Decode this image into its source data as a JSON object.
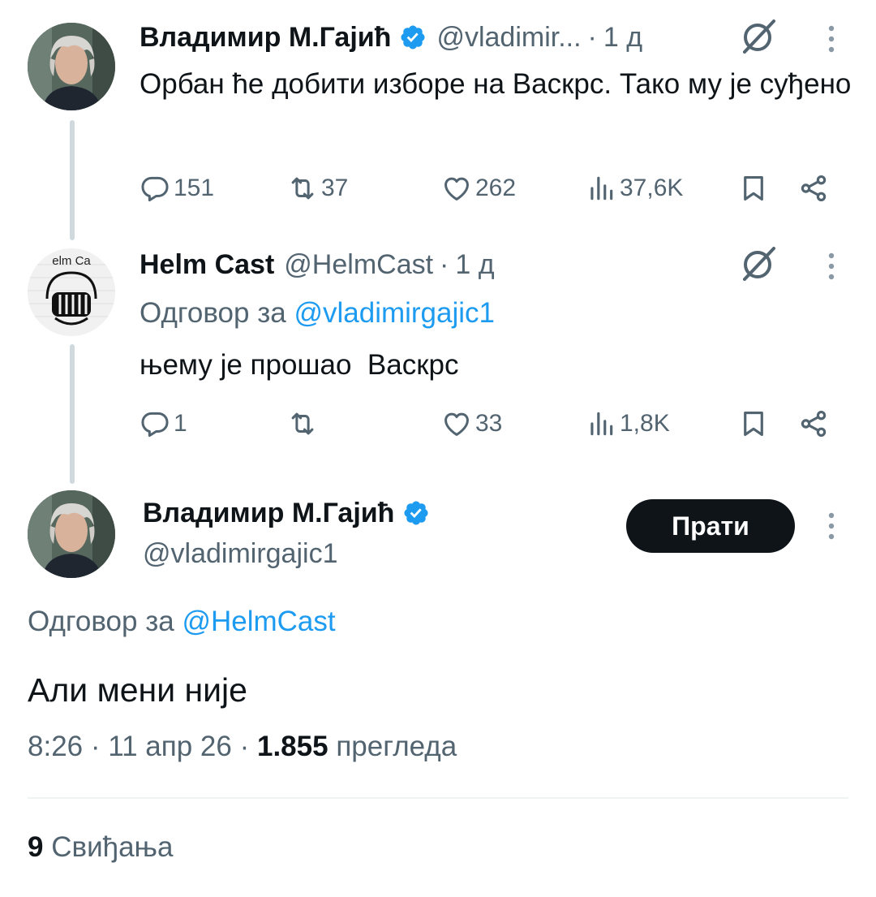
{
  "tweet1": {
    "author_name": "Владимир М.Гајић",
    "handle": "@vladimir...",
    "separator": "·",
    "time": "1 д",
    "text": "Орбан ће добити изборе на Васкрс. Тако му је суђено",
    "replies": "151",
    "reposts": "37",
    "likes": "262",
    "views": "37,6K",
    "avatar_icon": "person-avatar",
    "grok_icon": "grok-icon"
  },
  "tweet2": {
    "author_name": "Helm Cast",
    "handle": "@HelmCast",
    "separator": "·",
    "time": "1 д",
    "reply_prefix": "Одговор за",
    "reply_mention": "@vladimirgajic1",
    "text": "њему је прошао  Васкрс",
    "replies": "1",
    "reposts": "",
    "likes": "33",
    "views": "1,8K",
    "avatar_icon": "microphone-logo",
    "avatar_logo_text": "elm Ca"
  },
  "main_tweet": {
    "author_name": "Владимир М.Гајић",
    "handle": "@vladimirgajic1",
    "follow_label": "Прати",
    "reply_prefix": "Одговор за",
    "reply_mention": "@HelmCast",
    "text": "Али мени није",
    "time": "8:26",
    "sep1": "·",
    "date": "11 апр 26",
    "sep2": "·",
    "view_count": "1.855",
    "views_label": "прегледа",
    "likes_count": "9",
    "likes_label": "Свиђања"
  },
  "colors": {
    "text_primary": "#0f1419",
    "text_secondary": "#536471",
    "accent_blue": "#1d9bf0",
    "thread_line": "#cfd9de",
    "divider": "#eff3f4"
  }
}
